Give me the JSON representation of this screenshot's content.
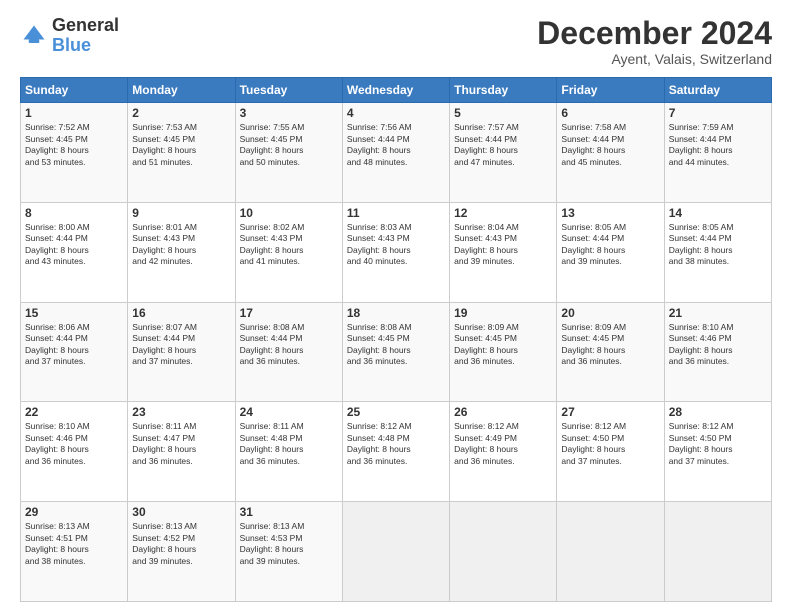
{
  "logo": {
    "text_general": "General",
    "text_blue": "Blue"
  },
  "title": "December 2024",
  "location": "Ayent, Valais, Switzerland",
  "days_of_week": [
    "Sunday",
    "Monday",
    "Tuesday",
    "Wednesday",
    "Thursday",
    "Friday",
    "Saturday"
  ],
  "weeks": [
    [
      {
        "num": "1",
        "sunrise": "7:52 AM",
        "sunset": "4:45 PM",
        "daylight": "8 hours and 53 minutes."
      },
      {
        "num": "2",
        "sunrise": "7:53 AM",
        "sunset": "4:45 PM",
        "daylight": "8 hours and 51 minutes."
      },
      {
        "num": "3",
        "sunrise": "7:55 AM",
        "sunset": "4:45 PM",
        "daylight": "8 hours and 50 minutes."
      },
      {
        "num": "4",
        "sunrise": "7:56 AM",
        "sunset": "4:44 PM",
        "daylight": "8 hours and 48 minutes."
      },
      {
        "num": "5",
        "sunrise": "7:57 AM",
        "sunset": "4:44 PM",
        "daylight": "8 hours and 47 minutes."
      },
      {
        "num": "6",
        "sunrise": "7:58 AM",
        "sunset": "4:44 PM",
        "daylight": "8 hours and 45 minutes."
      },
      {
        "num": "7",
        "sunrise": "7:59 AM",
        "sunset": "4:44 PM",
        "daylight": "8 hours and 44 minutes."
      }
    ],
    [
      {
        "num": "8",
        "sunrise": "8:00 AM",
        "sunset": "4:44 PM",
        "daylight": "8 hours and 43 minutes."
      },
      {
        "num": "9",
        "sunrise": "8:01 AM",
        "sunset": "4:43 PM",
        "daylight": "8 hours and 42 minutes."
      },
      {
        "num": "10",
        "sunrise": "8:02 AM",
        "sunset": "4:43 PM",
        "daylight": "8 hours and 41 minutes."
      },
      {
        "num": "11",
        "sunrise": "8:03 AM",
        "sunset": "4:43 PM",
        "daylight": "8 hours and 40 minutes."
      },
      {
        "num": "12",
        "sunrise": "8:04 AM",
        "sunset": "4:43 PM",
        "daylight": "8 hours and 39 minutes."
      },
      {
        "num": "13",
        "sunrise": "8:05 AM",
        "sunset": "4:44 PM",
        "daylight": "8 hours and 39 minutes."
      },
      {
        "num": "14",
        "sunrise": "8:05 AM",
        "sunset": "4:44 PM",
        "daylight": "8 hours and 38 minutes."
      }
    ],
    [
      {
        "num": "15",
        "sunrise": "8:06 AM",
        "sunset": "4:44 PM",
        "daylight": "8 hours and 37 minutes."
      },
      {
        "num": "16",
        "sunrise": "8:07 AM",
        "sunset": "4:44 PM",
        "daylight": "8 hours and 37 minutes."
      },
      {
        "num": "17",
        "sunrise": "8:08 AM",
        "sunset": "4:44 PM",
        "daylight": "8 hours and 36 minutes."
      },
      {
        "num": "18",
        "sunrise": "8:08 AM",
        "sunset": "4:45 PM",
        "daylight": "8 hours and 36 minutes."
      },
      {
        "num": "19",
        "sunrise": "8:09 AM",
        "sunset": "4:45 PM",
        "daylight": "8 hours and 36 minutes."
      },
      {
        "num": "20",
        "sunrise": "8:09 AM",
        "sunset": "4:45 PM",
        "daylight": "8 hours and 36 minutes."
      },
      {
        "num": "21",
        "sunrise": "8:10 AM",
        "sunset": "4:46 PM",
        "daylight": "8 hours and 36 minutes."
      }
    ],
    [
      {
        "num": "22",
        "sunrise": "8:10 AM",
        "sunset": "4:46 PM",
        "daylight": "8 hours and 36 minutes."
      },
      {
        "num": "23",
        "sunrise": "8:11 AM",
        "sunset": "4:47 PM",
        "daylight": "8 hours and 36 minutes."
      },
      {
        "num": "24",
        "sunrise": "8:11 AM",
        "sunset": "4:48 PM",
        "daylight": "8 hours and 36 minutes."
      },
      {
        "num": "25",
        "sunrise": "8:12 AM",
        "sunset": "4:48 PM",
        "daylight": "8 hours and 36 minutes."
      },
      {
        "num": "26",
        "sunrise": "8:12 AM",
        "sunset": "4:49 PM",
        "daylight": "8 hours and 36 minutes."
      },
      {
        "num": "27",
        "sunrise": "8:12 AM",
        "sunset": "4:50 PM",
        "daylight": "8 hours and 37 minutes."
      },
      {
        "num": "28",
        "sunrise": "8:12 AM",
        "sunset": "4:50 PM",
        "daylight": "8 hours and 37 minutes."
      }
    ],
    [
      {
        "num": "29",
        "sunrise": "8:13 AM",
        "sunset": "4:51 PM",
        "daylight": "8 hours and 38 minutes."
      },
      {
        "num": "30",
        "sunrise": "8:13 AM",
        "sunset": "4:52 PM",
        "daylight": "8 hours and 39 minutes."
      },
      {
        "num": "31",
        "sunrise": "8:13 AM",
        "sunset": "4:53 PM",
        "daylight": "8 hours and 39 minutes."
      },
      null,
      null,
      null,
      null
    ]
  ]
}
